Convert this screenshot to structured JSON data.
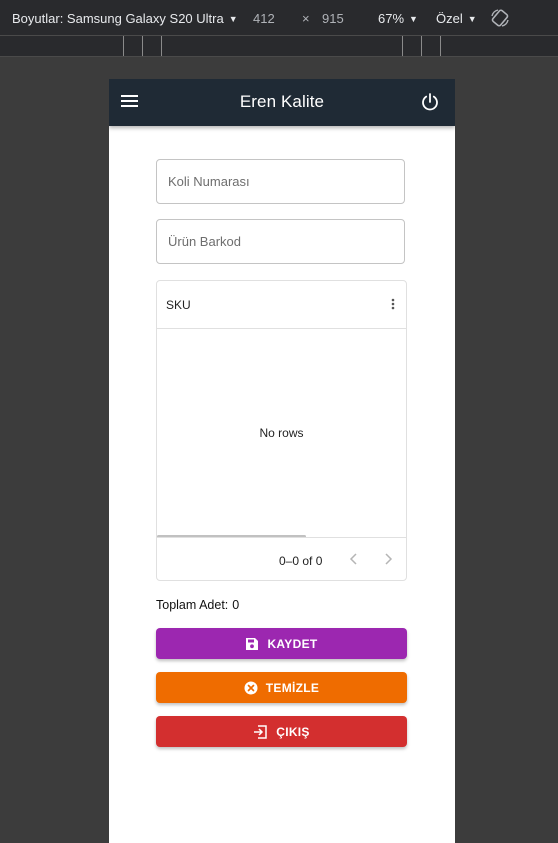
{
  "devtools": {
    "device_label": "Boyutlar: Samsung Galaxy S20 Ultra",
    "width": "412",
    "times": "×",
    "height": "915",
    "zoom": "67%",
    "throttle": "Özel"
  },
  "app": {
    "title": "Eren Kalite",
    "menu_icon": "menu-icon",
    "power_icon": "power-icon"
  },
  "form": {
    "box_number_placeholder": "Koli Numarası",
    "box_number_value": "",
    "barcode_placeholder": "Ürün Barkod",
    "barcode_value": ""
  },
  "grid": {
    "columns": [
      "SKU"
    ],
    "empty_text": "No rows",
    "pagination": "0–0 of 0"
  },
  "total": {
    "label": "Toplam Adet:",
    "value": "0"
  },
  "buttons": {
    "save": "KAYDET",
    "clear": "TEMİZLE",
    "exit": "ÇIKIŞ"
  },
  "colors": {
    "appbar": "#1f2a35",
    "save": "#9c27b0",
    "clear": "#ef6c00",
    "exit": "#d32f2f"
  }
}
